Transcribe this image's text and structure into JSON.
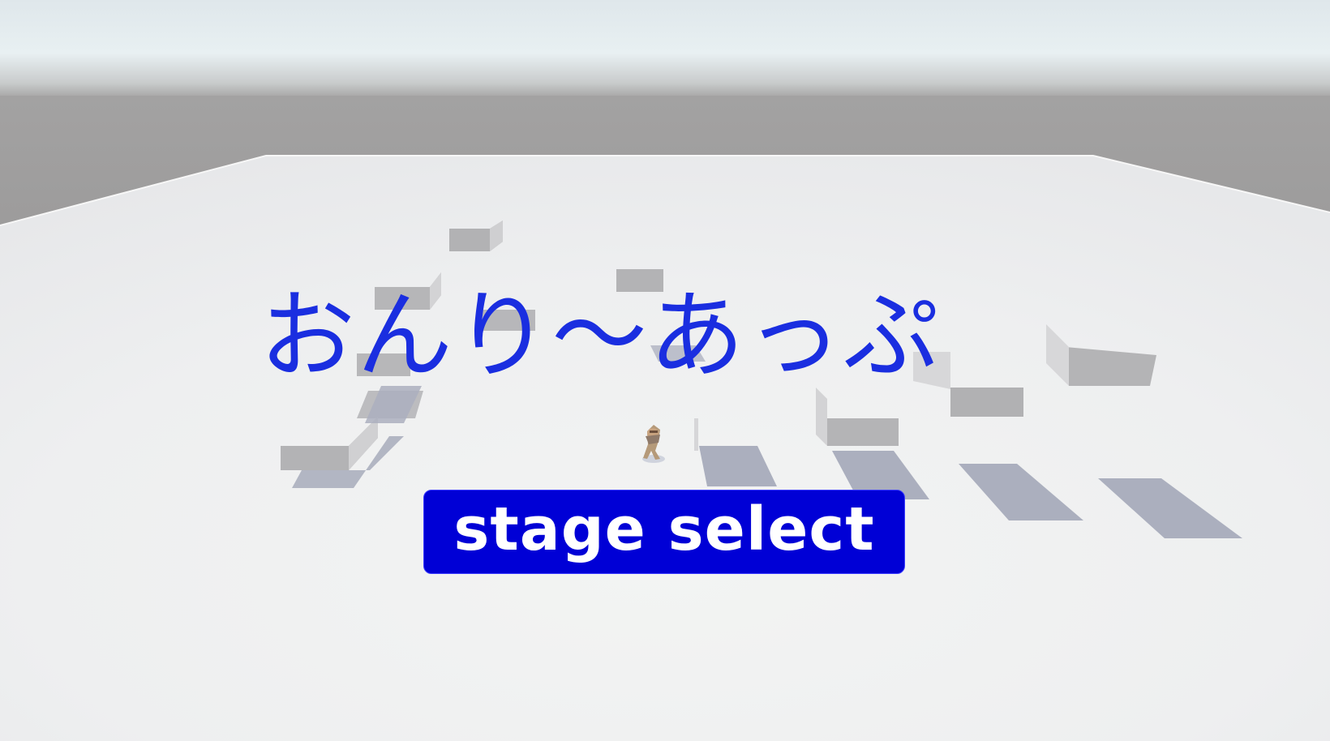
{
  "title_screen": {
    "game_title": "おんり〜あっぷ",
    "stage_select_label": "stage select"
  },
  "colors": {
    "title_text": "#1a2ee0",
    "button_background": "#0000d6",
    "button_text": "#ffffff",
    "floor": "#f0f0f0",
    "horizon": "#9c9c9c",
    "sky": "#e6eef2",
    "block_shadow": "#a9adbc"
  }
}
